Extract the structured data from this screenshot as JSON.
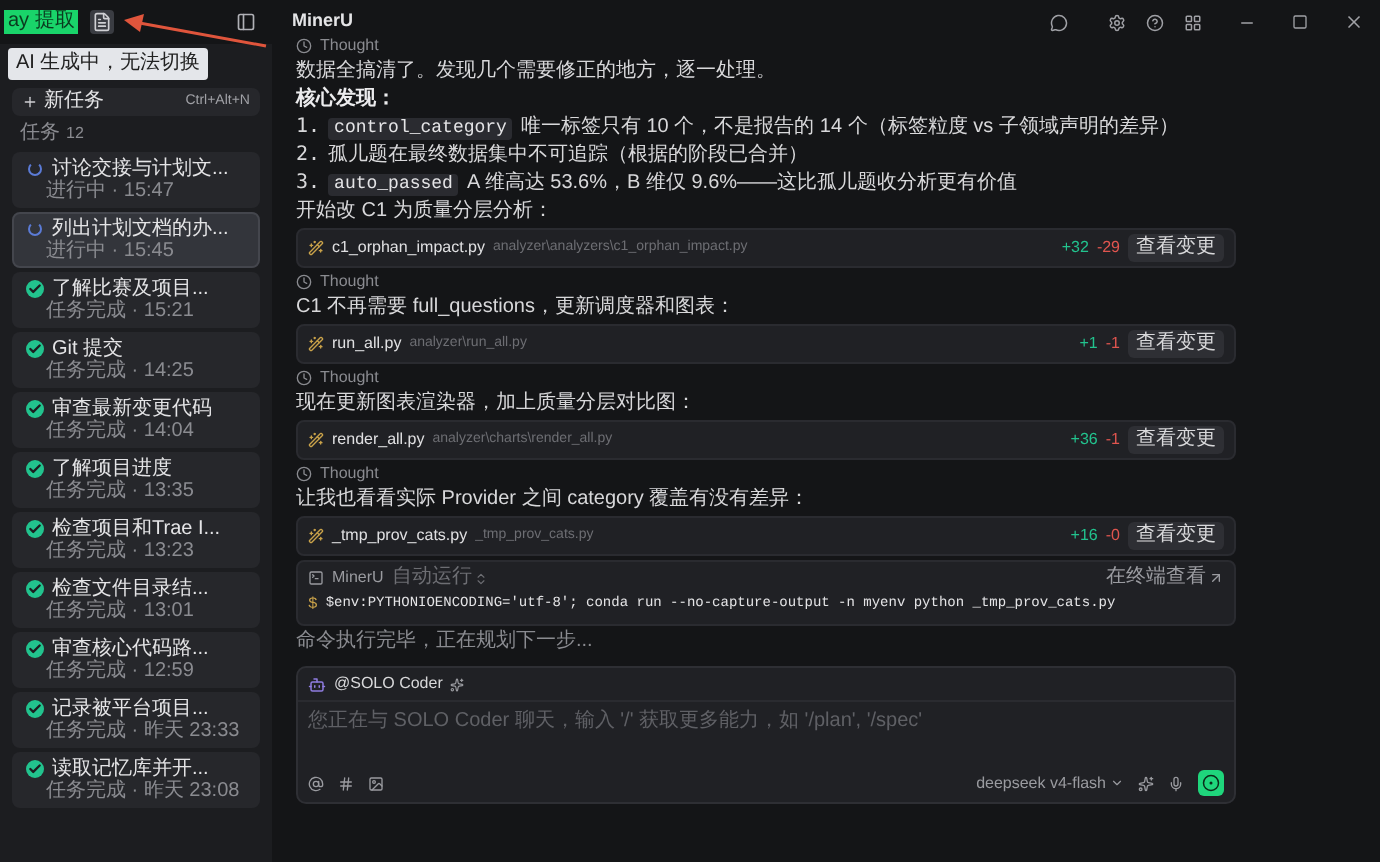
{
  "badge": "ay 提取",
  "tooltip": "AI 生成中，无法切换",
  "header": {
    "title": "MinerU"
  },
  "sidebar": {
    "new_task": {
      "label": "新任务",
      "shortcut": "Ctrl+Alt+N"
    },
    "section": {
      "label": "任务",
      "count": "12"
    },
    "tasks": [
      {
        "kind": "running",
        "title": "讨论交接与计划文...",
        "meta": "进行中 · 15:47",
        "selected": false
      },
      {
        "kind": "running",
        "title": "列出计划文档的办...",
        "meta": "进行中 · 15:45",
        "selected": true
      },
      {
        "kind": "done",
        "title": "了解比赛及项目...",
        "meta": "任务完成 · 15:21",
        "selected": false
      },
      {
        "kind": "done",
        "title": "Git 提交",
        "meta": "任务完成 · 14:25",
        "selected": false
      },
      {
        "kind": "done",
        "title": "审查最新变更代码",
        "meta": "任务完成 · 14:04",
        "selected": false
      },
      {
        "kind": "done",
        "title": "了解项目进度",
        "meta": "任务完成 · 13:35",
        "selected": false
      },
      {
        "kind": "done",
        "title": "检查项目和Trae I...",
        "meta": "任务完成 · 13:23",
        "selected": false
      },
      {
        "kind": "done",
        "title": "检查文件目录结...",
        "meta": "任务完成 · 13:01",
        "selected": false
      },
      {
        "kind": "done",
        "title": "审查核心代码路...",
        "meta": "任务完成 · 12:59",
        "selected": false
      },
      {
        "kind": "done",
        "title": "记录被平台项目...",
        "meta": "任务完成 · 昨天 23:33",
        "selected": false
      },
      {
        "kind": "done",
        "title": "读取记忆库并开...",
        "meta": "任务完成 · 昨天 23:08",
        "selected": false
      }
    ]
  },
  "messages": [
    {
      "kind": "thought",
      "label": "Thought"
    },
    {
      "kind": "text",
      "text": "数据全搞清了。发现几个需要修正的地方，逐一处理。"
    },
    {
      "kind": "heading",
      "text": "核心发现："
    },
    {
      "kind": "list_item",
      "number": "1.",
      "code": "control_category",
      "text": "唯一标签只有 10 个，不是报告的 14 个（标签粒度 vs 子领域声明的差异）"
    },
    {
      "kind": "list_item",
      "number": "2.",
      "text": "孤儿题在最终数据集中不可追踪（根据的阶段已合并）"
    },
    {
      "kind": "list_item",
      "number": "3.",
      "code": "auto_passed",
      "text": "A 维高达 53.6%，B 维仅 9.6%——这比孤儿题收分析更有价值"
    },
    {
      "kind": "text",
      "text": "开始改 C1 为质量分层分析："
    },
    {
      "kind": "file",
      "name": "c1_orphan_impact.py",
      "path": "analyzer\\analyzers\\c1_orphan_impact.py",
      "added": "+32",
      "removed": "-29",
      "button": "查看变更"
    },
    {
      "kind": "thought",
      "label": "Thought"
    },
    {
      "kind": "text",
      "text": "C1 不再需要 full_questions，更新调度器和图表："
    },
    {
      "kind": "file",
      "name": "run_all.py",
      "path": "analyzer\\run_all.py",
      "added": "+1",
      "removed": "-1",
      "button": "查看变更"
    },
    {
      "kind": "thought",
      "label": "Thought"
    },
    {
      "kind": "text",
      "text": "现在更新图表渲染器，加上质量分层对比图："
    },
    {
      "kind": "file",
      "name": "render_all.py",
      "path": "analyzer\\charts\\render_all.py",
      "added": "+36",
      "removed": "-1",
      "button": "查看变更"
    },
    {
      "kind": "thought",
      "label": "Thought"
    },
    {
      "kind": "text",
      "text": "让我也看看实际 Provider 之间 category 覆盖有没有差异："
    },
    {
      "kind": "file",
      "name": "_tmp_prov_cats.py",
      "path": "_tmp_prov_cats.py",
      "added": "+16",
      "removed": "-0",
      "button": "查看变更"
    },
    {
      "kind": "terminal",
      "title": "MinerU",
      "mode": "自动运行",
      "link": "在终端查看",
      "prompt": "$",
      "command": "$env:PYTHONIOENCODING='utf-8'; conda run --no-capture-output -n myenv python _tmp_prov_cats.py"
    },
    {
      "kind": "status",
      "text": "命令执行完毕，正在规划下一步..."
    }
  ],
  "composer": {
    "agent": "@SOLO Coder",
    "placeholder": "您正在与 SOLO Coder 聊天，输入 '/' 获取更多能力，如 '/plan', '/spec'",
    "model": "deepseek v4-flash"
  }
}
